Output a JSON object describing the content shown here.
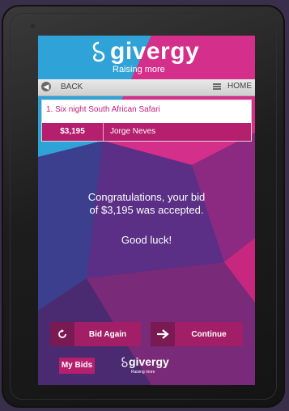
{
  "colors": {
    "brand": "#b51f6e",
    "brand_dark": "#7a1a52",
    "screen_bg": "#6b2a78"
  },
  "header": {
    "logo_text": "givergy",
    "tagline": "Raising more"
  },
  "nav": {
    "back_label": "BACK",
    "home_label": "HOME",
    "back_icon": "arrow-left-icon",
    "home_icon": "menu-icon"
  },
  "item": {
    "title": "1. Six night South African Safari",
    "bid_amount": "$3,195",
    "bidder": "Jorge Neves"
  },
  "message": {
    "line1": "Congratulations, your bid",
    "line2": "of $3,195 was accepted.",
    "line3": "Good luck!"
  },
  "actions": {
    "bid_again_label": "Bid Again",
    "continue_label": "Continue",
    "bid_again_icon": "refresh-icon",
    "continue_icon": "arrow-right-icon"
  },
  "footer": {
    "my_bids_label": "My Bids",
    "logo_text": "givergy",
    "tagline": "Raising more"
  }
}
